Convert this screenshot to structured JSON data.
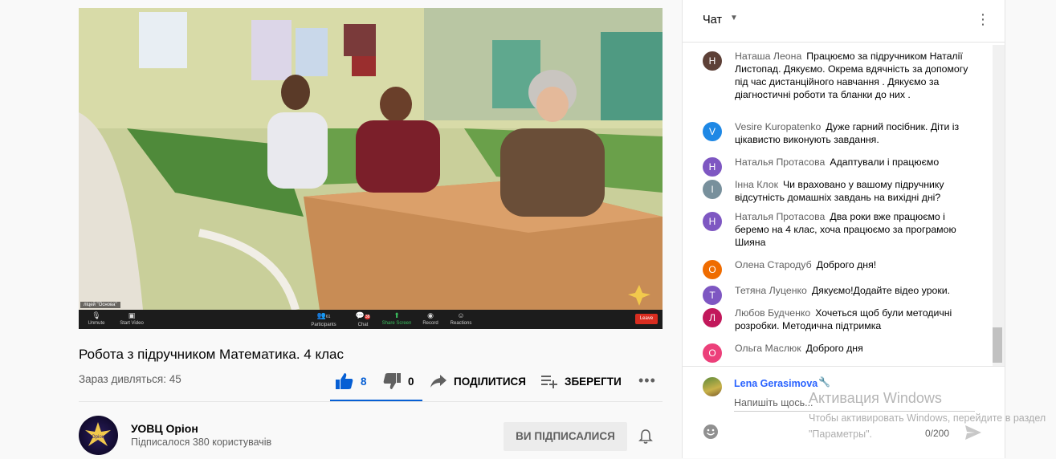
{
  "video": {
    "participant_label": "ліцей \"Основа\"",
    "toolbar": {
      "unmute": "Unmute",
      "start_video": "Start Video",
      "participants": "Participants",
      "participants_count": "61",
      "chat": "Chat",
      "chat_badge": "38",
      "share_screen": "Share Screen",
      "record": "Record",
      "reactions": "Reactions",
      "leave": "Leave"
    }
  },
  "title": "Робота з підручником Математика. 4 клас",
  "viewers": "Зараз дивляться: 45",
  "actions": {
    "likes": "8",
    "dislikes": "0",
    "share": "ПОДІЛИТИСЯ",
    "save": "ЗБЕРЕГТИ",
    "more": "•••"
  },
  "channel": {
    "name": "УОВЦ Оріон",
    "subscribers": "Підписалося 380 користувачів",
    "subscribe_label": "ВИ ПІДПИСАЛИСЯ",
    "avatar_text": "Оріон"
  },
  "chat": {
    "title": "Чат",
    "kebab": "⋮",
    "messages": [
      {
        "initial": "Н",
        "color": "#5d4037",
        "author": "Наташа Леона",
        "text": "Працюємо за підручником Наталії Листопад. Дякуємо. Окрема вдячність за допомогу під час дистанційного навчання . Дякуємо за діагностичні роботи та бланки до них ."
      },
      {
        "initial": "V",
        "color": "#1e88e5",
        "author": "Vesire Kuropatenko",
        "text": "Дуже гарний посібник. Діти із цікавистю виконують завдання."
      },
      {
        "initial": "Н",
        "color": "#7e57c2",
        "author": "Наталья Протасова",
        "text": "Адаптували і працюємо"
      },
      {
        "initial": "І",
        "color": "#78909c",
        "author": "Інна Клок",
        "text": "Чи враховано у вашому підручнику відсутність домашніх завдань на вихідні дні?"
      },
      {
        "initial": "Н",
        "color": "#7e57c2",
        "author": "Наталья Протасова",
        "text": "Два роки вже працюємо і беремо на 4 клас, хоча працюємо за програмою Шияна"
      },
      {
        "initial": "О",
        "color": "#ef6c00",
        "author": "Олена Стародуб",
        "text": "Доброго дня!"
      },
      {
        "initial": "Т",
        "color": "#7e57c2",
        "author": "Тетяна Луценко",
        "text": "Дякуємо!Додайте відео уроки."
      },
      {
        "initial": "Л",
        "color": "#c2185b",
        "author": "Любов Будченко",
        "text": "Хочеться щоб були методичні розробки. Методична підтримка"
      },
      {
        "initial": "О",
        "color": "#ec407a",
        "author": "Ольга Маслюк",
        "text": "Доброго дня"
      }
    ],
    "me_name": "Lena Gerasimova",
    "input_placeholder": "Напишіть щось...",
    "counter": "0/200"
  },
  "watermark": {
    "line1": "Активация Windows",
    "line2": "Чтобы активировать Windows, перейдите в раздел \"Параметры\"."
  }
}
